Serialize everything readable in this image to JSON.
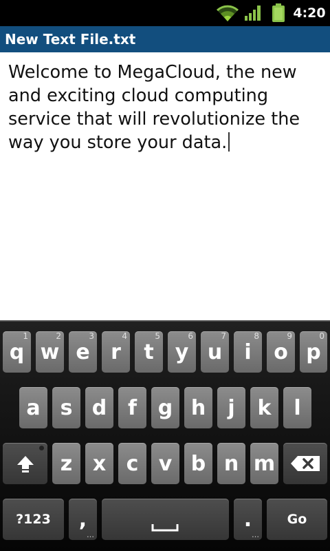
{
  "status_bar": {
    "time": "4:20",
    "icons": [
      "wifi-icon",
      "signal-icon",
      "battery-icon"
    ],
    "accent_color": "#8bc34a"
  },
  "app": {
    "title": "New Text File.txt",
    "title_bar_color": "#124e7e"
  },
  "editor": {
    "text": "Welcome to MegaCloud, the new and exciting cloud computing service that will revolutionize the way you store your data."
  },
  "keyboard": {
    "row1": [
      {
        "label": "q",
        "hint": "1"
      },
      {
        "label": "w",
        "hint": "2"
      },
      {
        "label": "e",
        "hint": "3"
      },
      {
        "label": "r",
        "hint": "4"
      },
      {
        "label": "t",
        "hint": "5"
      },
      {
        "label": "y",
        "hint": "6"
      },
      {
        "label": "u",
        "hint": "7"
      },
      {
        "label": "i",
        "hint": "8"
      },
      {
        "label": "o",
        "hint": "9"
      },
      {
        "label": "p",
        "hint": "0"
      }
    ],
    "row2": [
      {
        "label": "a"
      },
      {
        "label": "s"
      },
      {
        "label": "d"
      },
      {
        "label": "f"
      },
      {
        "label": "g"
      },
      {
        "label": "h"
      },
      {
        "label": "j"
      },
      {
        "label": "k"
      },
      {
        "label": "l"
      }
    ],
    "row3": [
      {
        "label": "z"
      },
      {
        "label": "x"
      },
      {
        "label": "c"
      },
      {
        "label": "v"
      },
      {
        "label": "b"
      },
      {
        "label": "n"
      },
      {
        "label": "m"
      }
    ],
    "symbols_label": "?123",
    "comma_label": ",",
    "period_label": ".",
    "go_label": "Go",
    "more_hint": "…",
    "shift_icon": "shift-icon",
    "backspace_icon": "backspace-icon",
    "space_icon": "space-bar-icon"
  }
}
